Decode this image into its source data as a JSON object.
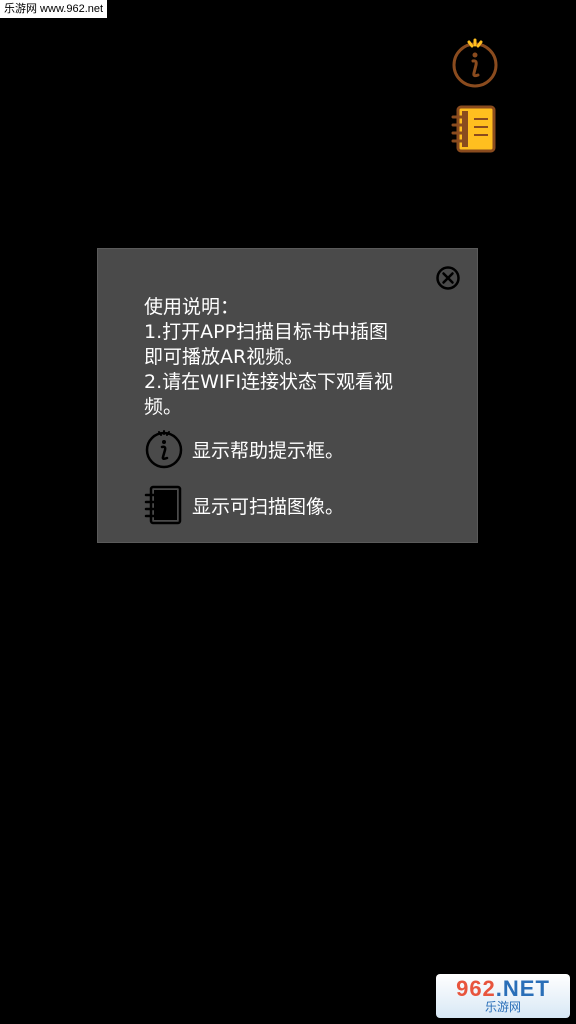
{
  "watermark_top": "乐游网 www.962.net",
  "toolbar": {
    "help_icon": "info-icon",
    "scan_icon": "notebook-icon"
  },
  "dialog": {
    "lines": [
      "使用说明：",
      "1.打开APP扫描目标书中插图",
      "即可播放AR视频。",
      "2.请在WIFI连接状态下观看视",
      "频。"
    ],
    "legend": [
      {
        "icon": "info-icon",
        "text": "显示帮助提示框。"
      },
      {
        "icon": "notebook-icon",
        "text": "显示可扫描图像。"
      }
    ],
    "close_icon": "close-icon"
  },
  "watermark_bottom": {
    "logo_num": "962",
    "logo_net": ".NET",
    "sub": "乐游网"
  },
  "colors": {
    "accent_orange": "#ffbf1f",
    "icon_brown": "#8a4b1e",
    "dialog_bg": "#4a4a4a"
  }
}
